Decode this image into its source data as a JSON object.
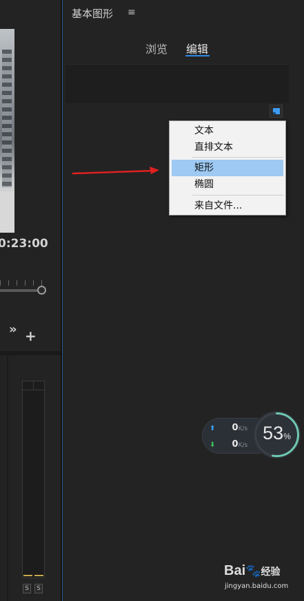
{
  "left_panel": {
    "timecode": "0:23:00",
    "more_label": "»",
    "add_label": "+",
    "solo_a": "S",
    "solo_b": "S"
  },
  "eg_panel": {
    "title": "基本图形",
    "menu_glyph": "≡",
    "tabs": [
      {
        "label": "浏览",
        "active": false
      },
      {
        "label": "编辑",
        "active": true
      }
    ]
  },
  "context_menu": {
    "items": [
      {
        "label": "文本",
        "highlighted": false
      },
      {
        "label": "直排文本",
        "highlighted": false
      },
      {
        "label": "矩形",
        "highlighted": true
      },
      {
        "label": "椭圆",
        "highlighted": false
      },
      {
        "label": "来自文件...",
        "highlighted": false
      }
    ]
  },
  "net_widget": {
    "upload_value": "0",
    "upload_unit": "K/s",
    "download_value": "0",
    "download_unit": "K/s",
    "percent": "53",
    "percent_sign": "%",
    "percent_fraction": 0.53
  },
  "watermark": {
    "logo": "Bai",
    "logo_suffix": "经验",
    "url": "jingyan.baidu.com"
  },
  "colors": {
    "accent": "#2e8ae6",
    "menu_highlight": "#9dc9f2",
    "annotation_arrow": "#e02020",
    "dial_ring": "#6fc8b0"
  }
}
